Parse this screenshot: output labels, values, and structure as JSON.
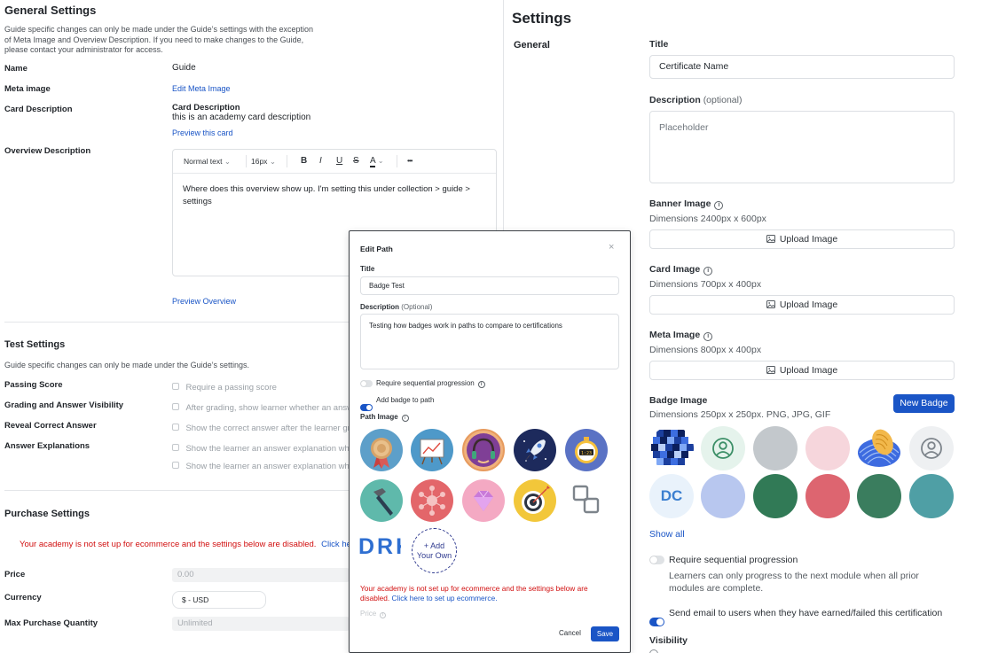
{
  "left": {
    "general": {
      "title": "General Settings",
      "note": "Guide specific changes can only be made under the Guide’s settings with the exception of Meta Image and Overview Description. If you need to make changes to the Guide, please contact your administrator for access.",
      "name_label": "Name",
      "name_value": "Guide",
      "meta_label": "Meta image",
      "meta_link": "Edit Meta Image",
      "card_label": "Card Description",
      "card_title": "Card Description",
      "card_text": "this is an academy card description",
      "card_preview": "Preview this card",
      "overview_label": "Overview Description",
      "editor": {
        "style": "Normal text",
        "size": "16px",
        "bold": "B",
        "italic": "I",
        "underline": "U",
        "strike": "S",
        "color": "A",
        "more": "•••",
        "content": "Where does this overview show up. I'm setting this under collection > guide > settings"
      },
      "preview_overview": "Preview Overview"
    },
    "test": {
      "title": "Test Settings",
      "note": "Guide specific changes can only be made under the Guide’s settings.",
      "rows": [
        {
          "label": "Passing Score",
          "option": "Require a passing score"
        },
        {
          "label": "Grading and Answer Visibility",
          "option": "After grading, show learner whether an answer was correct"
        },
        {
          "label": "Reveal Correct Answer",
          "option": "Show the correct answer after the learner grades"
        },
        {
          "label": "Answer Explanations",
          "option": "Show the learner an answer explanation when correct"
        },
        {
          "label": "",
          "option": "Show the learner an answer explanation when incorrect"
        }
      ]
    },
    "purchase": {
      "title": "Purchase Settings",
      "warning": "Your academy is not set up for ecommerce and the settings below are disabled.",
      "warning_link": "Click here to set up ecommerce.",
      "price_label": "Price",
      "price_value": "0.00",
      "currency_label": "Currency",
      "currency_value": "$ - USD",
      "max_label": "Max Purchase Quantity",
      "max_value": "Unlimited"
    }
  },
  "right": {
    "title": "Settings",
    "section": "General",
    "title_label": "Title",
    "title_value": "Certificate Name",
    "desc_label": "Description",
    "optional": "(optional)",
    "desc_placeholder": "Placeholder",
    "banner_label": "Banner Image",
    "banner_dims": "Dimensions 2400px x 600px",
    "upload": "Upload Image",
    "card_label": "Card Image",
    "card_dims": "Dimensions 700px x 400px",
    "meta_label": "Meta Image",
    "meta_dims": "Dimensions 800px x 400px",
    "badge_label": "Badge Image",
    "badge_dims": "Dimensions 250px x 250px. PNG, JPG, GIF",
    "new_badge": "New Badge",
    "dc_text": "DC",
    "show_all": "Show all",
    "seq_label": "Require sequential progression",
    "seq_desc": "Learners can only progress to the next module when all prior modules are complete.",
    "email_label": "Send email to users when they have earned/failed this certification",
    "visibility_label": "Visibility",
    "accent": "#1a55c6"
  },
  "modal": {
    "title": "Edit Path",
    "close": "×",
    "title_label": "Title",
    "title_value": "Badge Test",
    "desc_label": "Description",
    "desc_optional": "(Optional)",
    "desc_value": "Testing how badges work in paths to compare to certifications",
    "seq_label": "Require sequential progression",
    "badge_toggle_label": "Add badge to path",
    "path_image_label": "Path Image",
    "add_own": "+ Add\nYour Own",
    "partial_text": "DRK",
    "warning": "Your academy is not set up for ecommerce and the settings below are disabled.",
    "warning_link": "Click here to set up ecommerce.",
    "price_label": "Price",
    "cancel": "Cancel",
    "save": "Save",
    "warning_color": "#d10f0f"
  }
}
